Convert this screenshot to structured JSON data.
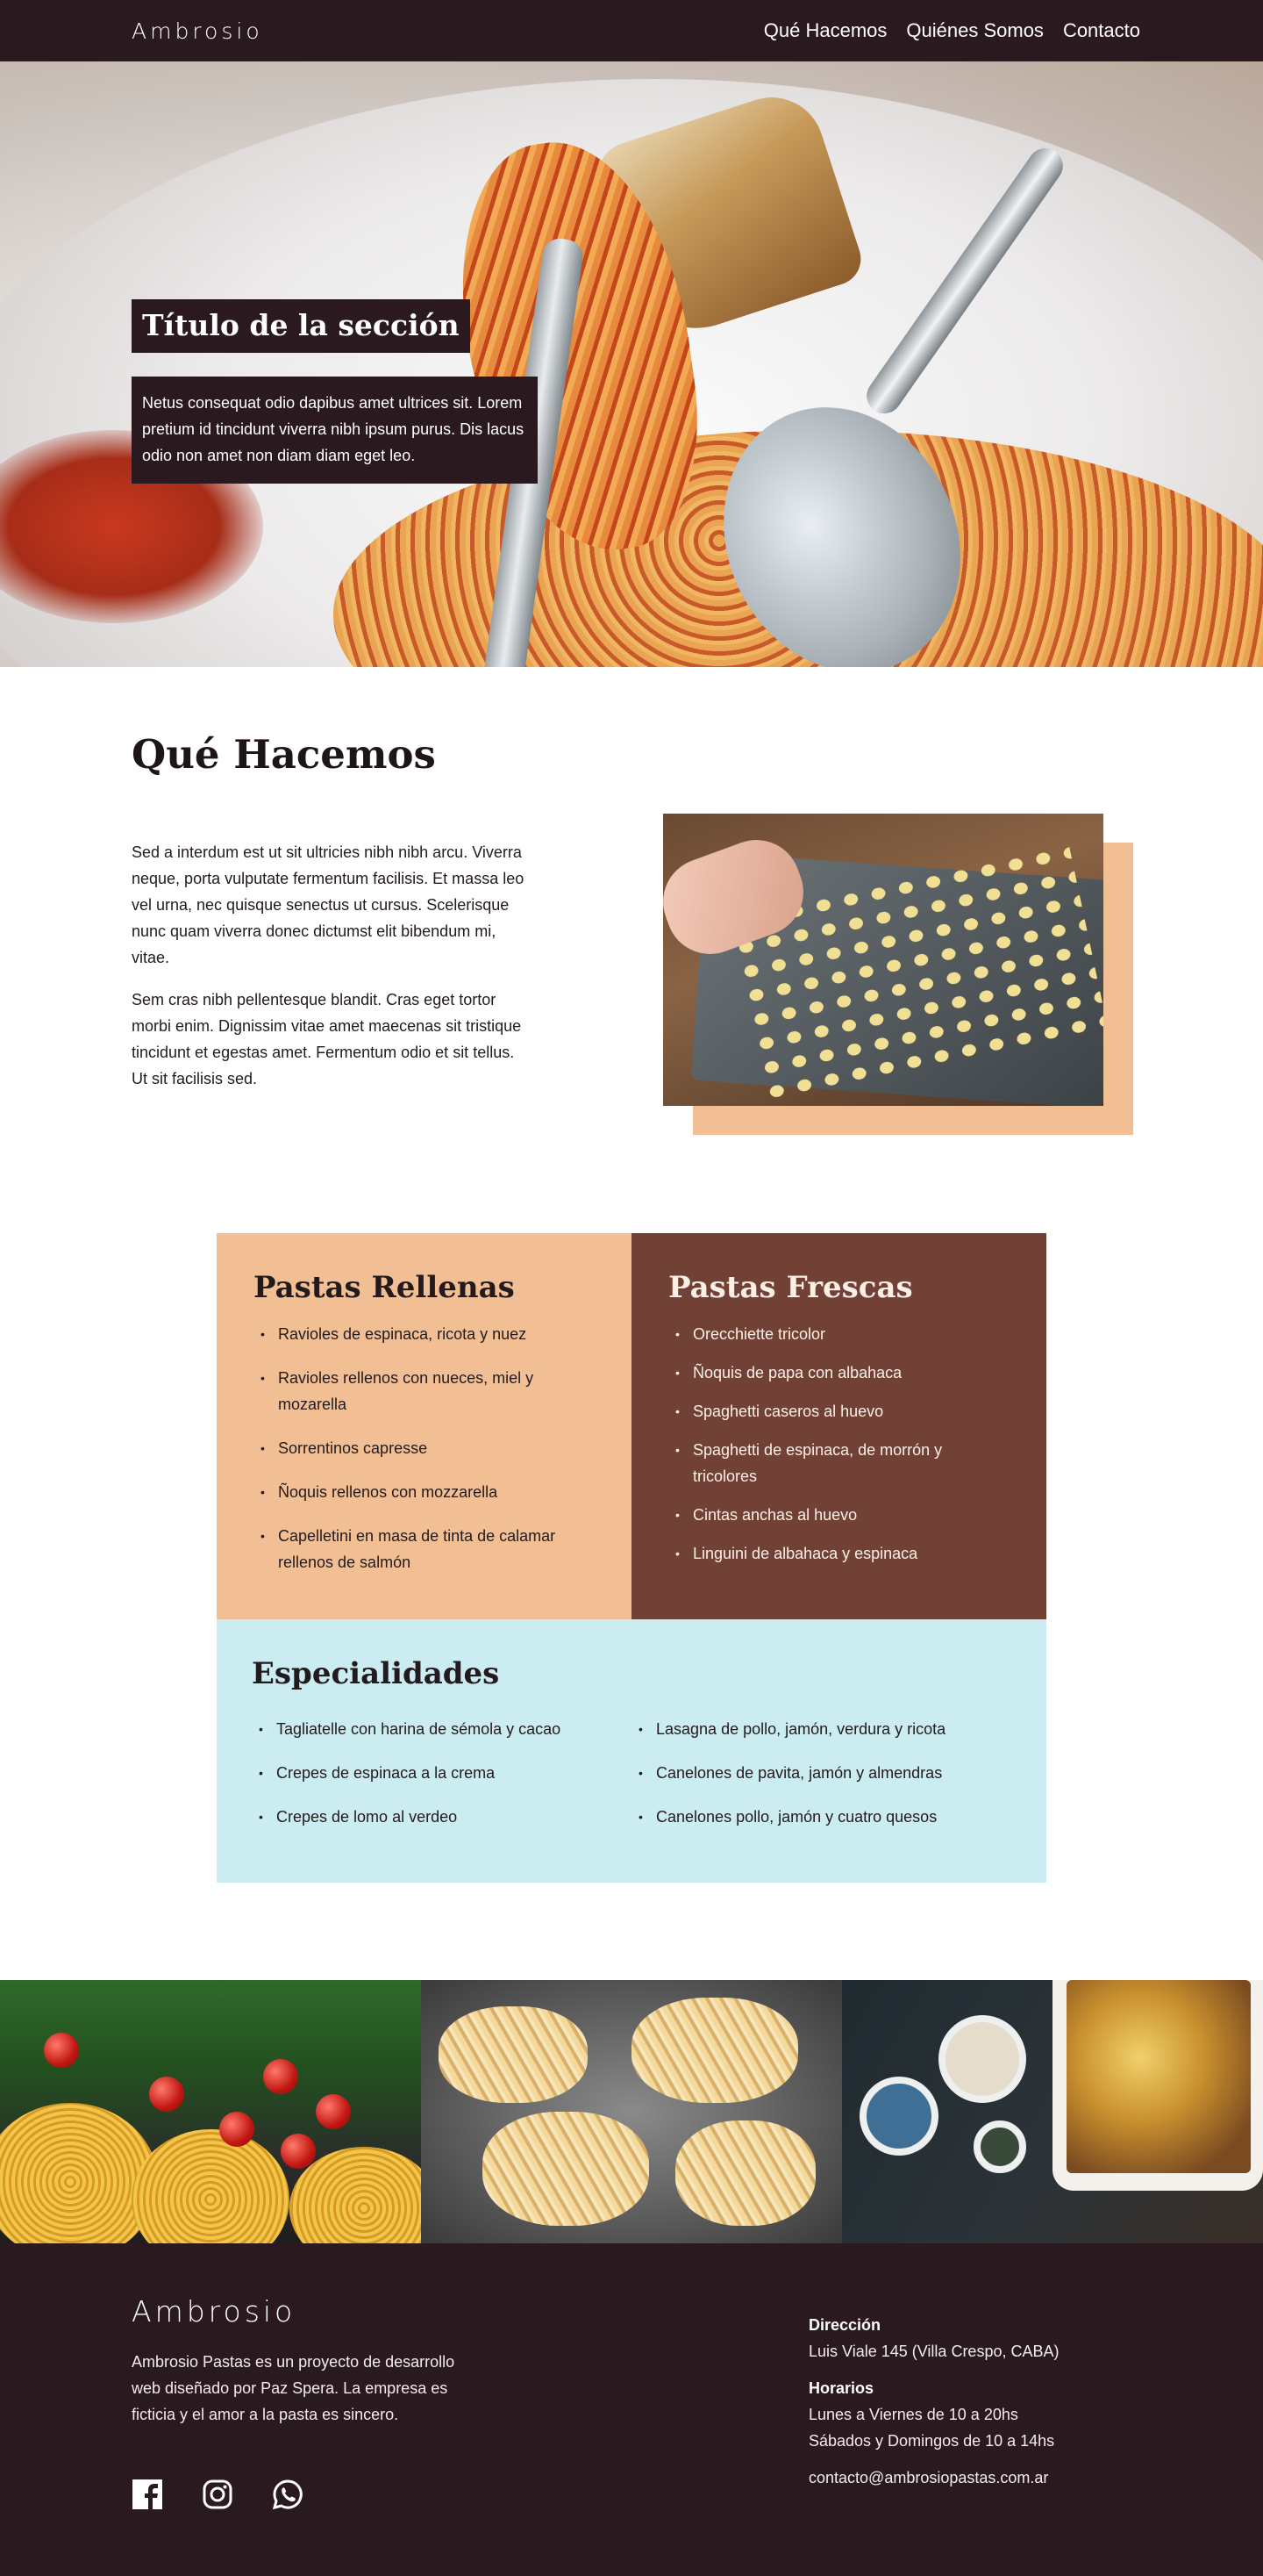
{
  "nav": {
    "brand": "Ambrosio",
    "links": [
      "Qué Hacemos",
      "Quiénes Somos",
      "Contacto"
    ]
  },
  "hero": {
    "title": "Título de la sección",
    "text": "Netus consequat odio dapibus amet ultrices sit. Lorem pretium id tincidunt viverra nibh ipsum purus. Dis lacus odio non amet non diam diam eget leo."
  },
  "about": {
    "title": "Qué Hacemos",
    "paragraphs": [
      "Sed a interdum est ut sit ultricies nibh nibh arcu. Viverra neque, porta vulputate fermentum facilisis. Et massa leo vel urna, nec quisque senectus ut cursus. Scelerisque nunc quam viverra donec dictumst elit bibendum mi, vitae.",
      "Sem cras nibh pellentesque blandit. Cras eget tortor morbi enim. Dignissim vitae amet maecenas sit tristique tincidunt et egestas amet. Fermentum odio et sit tellus. Ut sit facilisis sed."
    ]
  },
  "menu": {
    "rellenas": {
      "title": "Pastas Rellenas",
      "items": [
        "Ravioles de espinaca, ricota y nuez",
        "Ravioles rellenos con nueces, miel y mozarella",
        "Sorrentinos capresse",
        "Ñoquis  rellenos con mozzarella",
        "Capelletini en masa de tinta de calamar rellenos de salmón"
      ]
    },
    "frescas": {
      "title": "Pastas Frescas",
      "items": [
        "Orecchiette tricolor",
        "Ñoquis de papa con albahaca",
        "Spaghetti caseros al huevo",
        "Spaghetti de espinaca, de morrón y tricolores",
        "Cintas anchas al huevo",
        "Linguini de albahaca y espinaca"
      ]
    },
    "especialidades": {
      "title": "Especialidades",
      "left": [
        "Tagliatelle con harina de sémola y cacao",
        "Crepes de espinaca a la crema",
        "Crepes de lomo al verdeo"
      ],
      "right": [
        "Lasagna de pollo, jamón, verdura y ricota",
        "Canelones de pavita, jamón y almendras",
        "Canelones pollo, jamón y cuatro quesos"
      ]
    }
  },
  "footer": {
    "brand": "Ambrosio",
    "about": "Ambrosio Pastas es un proyecto de desarrollo web diseñado por Paz Spera. La empresa es ficticia y el amor a la pasta es sincero.",
    "direccion_label": "Dirección",
    "direccion": "Luis Viale 145 (Villa Crespo, CABA)",
    "horarios_label": "Horarios",
    "horarios": [
      "Lunes a Viernes de 10 a 20hs",
      "Sábados y Domingos de 10 a 14hs"
    ],
    "email": "contacto@ambrosiopastas.com.ar",
    "social_icons": [
      "facebook-icon",
      "instagram-icon",
      "whatsapp-icon"
    ]
  },
  "colors": {
    "dark": "#2a1a1f",
    "peach": "#f1bf93",
    "brown": "#724136",
    "light_blue": "#cbecf0"
  }
}
